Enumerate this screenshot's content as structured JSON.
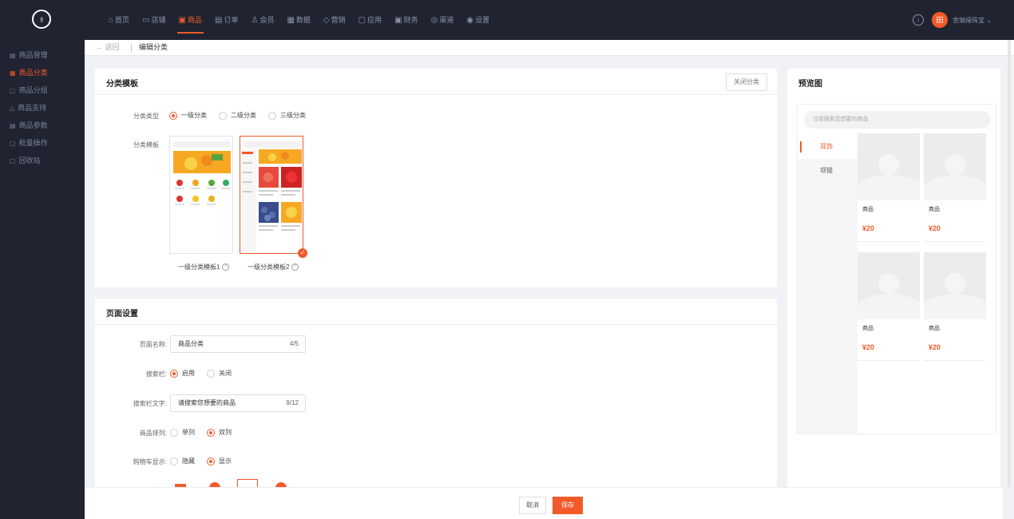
{
  "nav": {
    "items": [
      {
        "icon": "home-icon",
        "glyph": "⌂",
        "label": "首页"
      },
      {
        "icon": "store-icon",
        "glyph": "▭",
        "label": "店铺"
      },
      {
        "icon": "goods-icon",
        "glyph": "▣",
        "label": "商品"
      },
      {
        "icon": "order-icon",
        "glyph": "▤",
        "label": "订单"
      },
      {
        "icon": "member-icon",
        "glyph": "♙",
        "label": "会员"
      },
      {
        "icon": "data-icon",
        "glyph": "▦",
        "label": "数据"
      },
      {
        "icon": "marketing-icon",
        "glyph": "◇",
        "label": "营销"
      },
      {
        "icon": "app-icon",
        "glyph": "▢",
        "label": "应用"
      },
      {
        "icon": "finance-icon",
        "glyph": "▣",
        "label": "财务"
      },
      {
        "icon": "channel-icon",
        "glyph": "◎",
        "label": "渠道"
      },
      {
        "icon": "settings-icon",
        "glyph": "◉",
        "label": "设置"
      }
    ],
    "active": "商品",
    "user_initial": "田",
    "user_name": "金端缘珠宝",
    "accent": "#f25a2a"
  },
  "sidebar": {
    "items": [
      {
        "icon": "list-icon",
        "glyph": "▤",
        "label": "商品管理"
      },
      {
        "icon": "grid-icon",
        "glyph": "▦",
        "label": "商品分类"
      },
      {
        "icon": "group-icon",
        "glyph": "▢",
        "label": "商品分组"
      },
      {
        "icon": "support-icon",
        "glyph": "△",
        "label": "商品支持"
      },
      {
        "icon": "param-icon",
        "glyph": "▤",
        "label": "商品参数"
      },
      {
        "icon": "batch-icon",
        "glyph": "▢",
        "label": "批量操作"
      },
      {
        "icon": "recycle-icon",
        "glyph": "▢",
        "label": "回收站"
      }
    ],
    "active": "商品分类"
  },
  "crumb": {
    "back": "← 返回",
    "title": "编辑分类"
  },
  "template_card": {
    "title": "分类模板",
    "close_button": "关闭分类",
    "type_label": "分类类型",
    "type_options": [
      "一级分类",
      "二级分类",
      "三级分类"
    ],
    "type_selected": "一级分类",
    "template_label": "分类模板",
    "templates": [
      "一级分类模板1",
      "一级分类模板2"
    ],
    "template_selected": "一级分类模板2"
  },
  "page_card": {
    "title": "页面设置",
    "name_label": "页面名称:",
    "name_value": "商品分类",
    "name_count": "4/5",
    "search_label": "搜索栏:",
    "search_options": [
      "启用",
      "关闭"
    ],
    "search_selected": "启用",
    "search_text_label": "搜索栏文字:",
    "search_text_value": "请搜索您想要的商品",
    "search_text_count": "9/12",
    "layout_label": "商品排列:",
    "layout_options": [
      "单列",
      "双列"
    ],
    "layout_selected": "双列",
    "cart_label": "购物车显示:",
    "cart_options": [
      "隐藏",
      "显示"
    ],
    "cart_selected": "显示"
  },
  "footer": {
    "cancel": "取消",
    "save": "保存"
  },
  "preview": {
    "title": "预览图",
    "search_placeholder": "Q请搜索您想要的商品",
    "categories": [
      "耳饰",
      "项链"
    ],
    "active_category": "耳饰",
    "products": [
      {
        "name": "商品",
        "price": "¥20"
      },
      {
        "name": "商品",
        "price": "¥20"
      },
      {
        "name": "商品",
        "price": "¥20"
      },
      {
        "name": "商品",
        "price": "¥20"
      }
    ]
  }
}
